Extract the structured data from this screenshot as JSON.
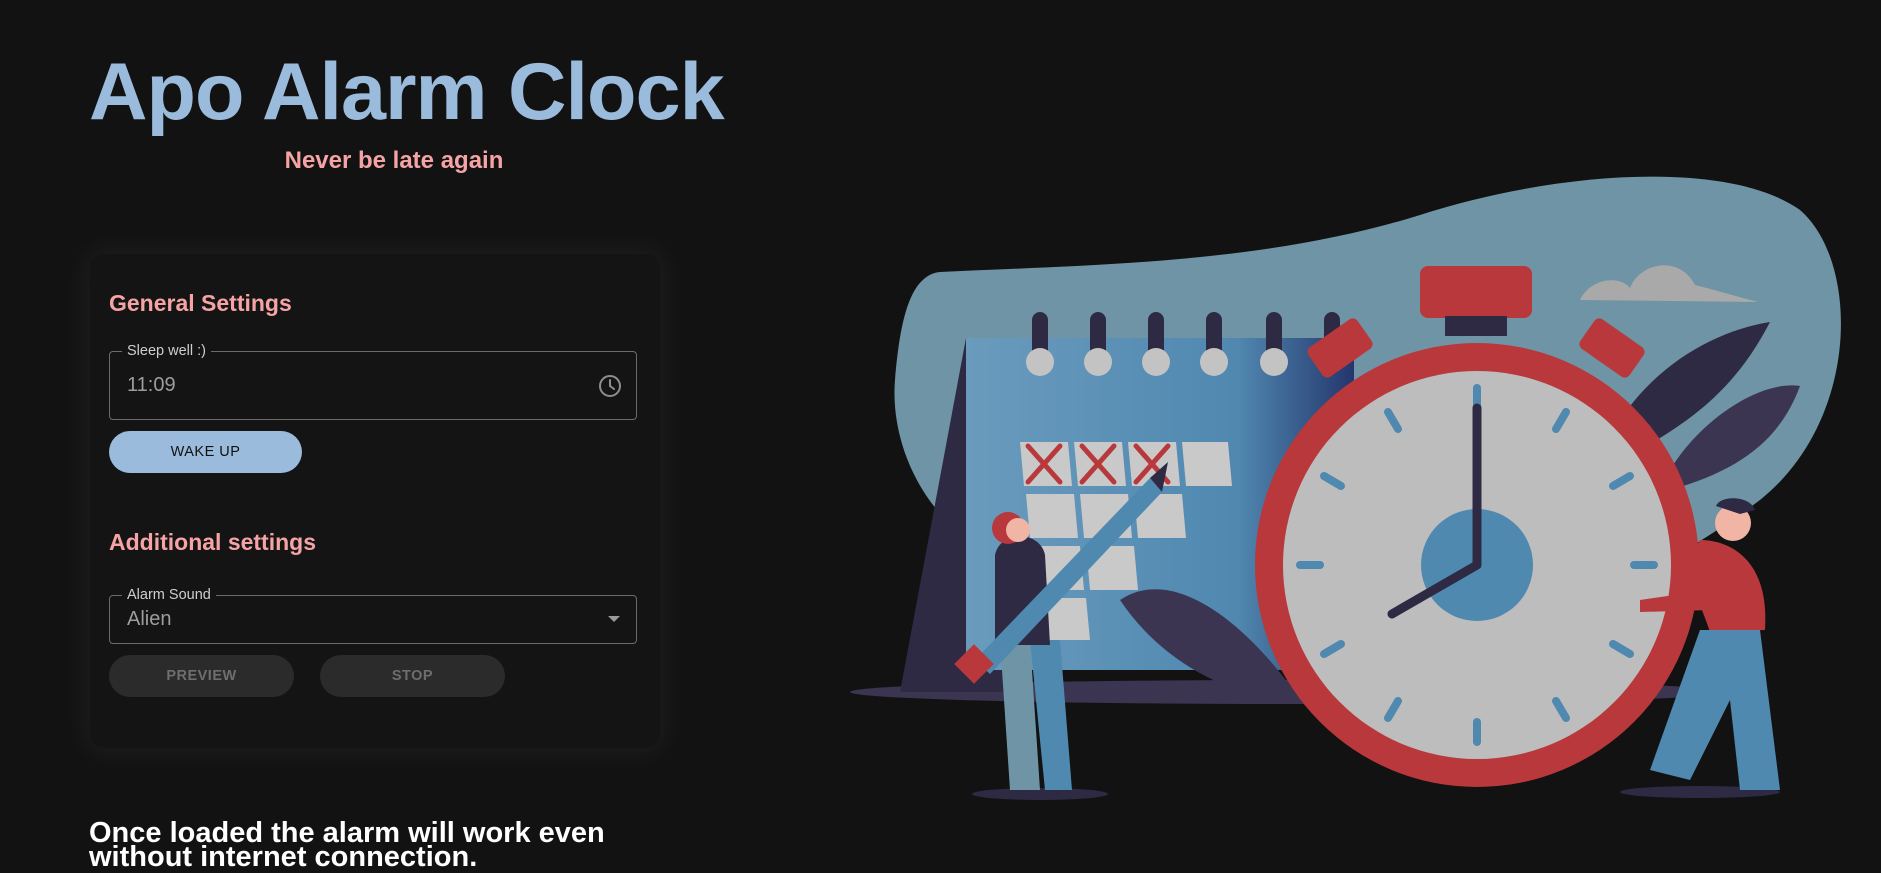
{
  "header": {
    "title": "Apo Alarm Clock",
    "subtitle": "Never be late again"
  },
  "general_settings": {
    "heading": "General Settings",
    "time_field": {
      "label": "Sleep well :)",
      "value": "11:09",
      "icon": "clock-icon"
    },
    "wake_button_label": "WAKE UP"
  },
  "additional_settings": {
    "heading": "Additional settings",
    "sound_field": {
      "label": "Alarm Sound",
      "value": "Alien",
      "icon": "dropdown-arrow-icon"
    },
    "preview_button_label": "PREVIEW",
    "stop_button_label": "STOP"
  },
  "footer": {
    "text": "Once loaded the alarm will work even without internet connection."
  },
  "colors": {
    "background": "#121212",
    "accent_blue": "#9bbbdc",
    "accent_pink": "#f5a3a5",
    "clock_red": "#b8383b"
  }
}
